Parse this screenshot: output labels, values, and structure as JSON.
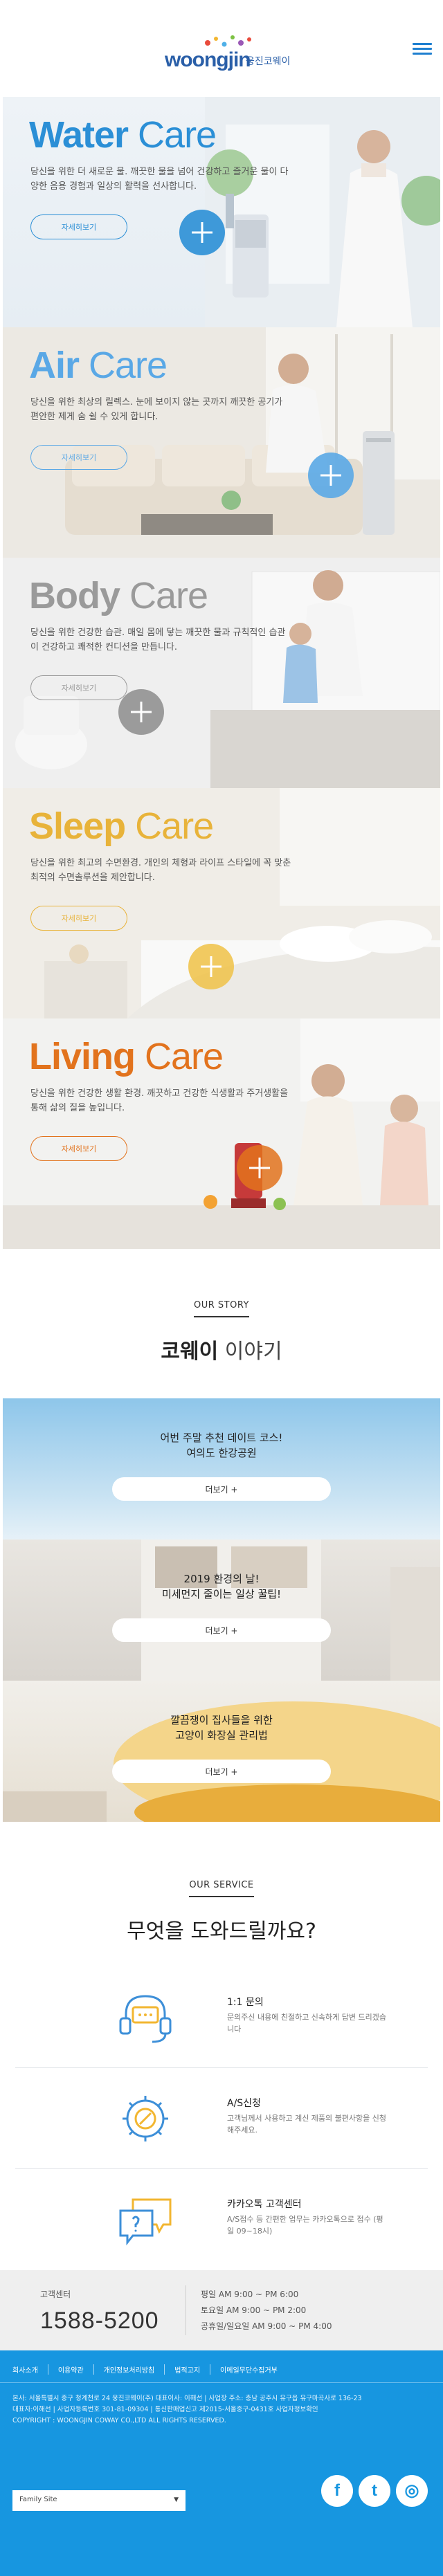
{
  "header": {
    "logo_word": "woongjin",
    "logo_kor": "웅진코웨이"
  },
  "cares": [
    {
      "word": "Water",
      "rest": " Care",
      "color": "#2b8fd6",
      "desc": "당신을 위한 더 새로운 물. 깨끗한 물을 넘어 건강하고 즐거운 물이 다양한 음용 경험과 일상의 활력을 선사합니다.",
      "more": "자세히보기"
    },
    {
      "word": "Air",
      "rest": " Care",
      "color": "#5aa8e6",
      "desc": "당신을 위한 최상의 릴렉스. 눈에 보이지 않는 곳까지 깨끗한 공기가 편안한 제게 숨 쉴 수 있게 합니다.",
      "more": "자세히보기"
    },
    {
      "word": "Body",
      "rest": " Care",
      "color": "#9a9a9a",
      "desc": "당신을 위한 건강한 습관. 매일 몸에 닿는 깨끗한 물과 규칙적인 습관이 건강하고 쾌적한 컨디션을 만듭니다.",
      "more": "자세히보기"
    },
    {
      "word": "Sleep",
      "rest": " Care",
      "color": "#e8b33a",
      "desc": "당신을 위한 최고의 수면환경. 개인의 체형과 라이프 스타일에 꼭 맞춘 최적의 수면솔루션을 제안합니다.",
      "more": "자세히보기"
    },
    {
      "word": "Living",
      "rest": " Care",
      "color": "#e2731d",
      "desc": "당신을 위한 건강한 생활 환경. 깨끗하고 건강한 식생활과 주거생활을 통해 삶의 질을 높입니다.",
      "more": "자세히보기"
    }
  ],
  "story": {
    "eyebrow": "OUR STORY",
    "title_bold": "코웨이",
    "title_light": " 이야기",
    "items": [
      {
        "line1": "어번 주말 추천 데이트 코스!",
        "line2": "여의도 한강공원",
        "button": "더보기 +"
      },
      {
        "line1": "2019 환경의 날!",
        "line2": "미세먼지 줄이는 일상 꿀팁!",
        "button": "더보기 +"
      },
      {
        "line1": "깔끔쟁이 집사들을 위한",
        "line2": "고양이 화장실 관리법",
        "button": "더보기 +"
      }
    ]
  },
  "service": {
    "eyebrow": "OUR SERVICE",
    "title": "무엇을 도와드릴까요?",
    "items": [
      {
        "icon": "headset-icon",
        "title": "1:1 문의",
        "desc": "문의주신 내용에 친절하고 신속하게 답변 드리겠습니다"
      },
      {
        "icon": "gear-wrench-icon",
        "title": "A/S신청",
        "desc": "고객님께서 사용하고 계신 제품의 불편사항을 신청해주세요."
      },
      {
        "icon": "chat-bubble-icon",
        "title": "카카오톡 고객센터",
        "desc": "A/S접수 등 간편한 업무는 카카오톡으로 접수 (평일 09~18시)"
      }
    ]
  },
  "call": {
    "label": "고객센터",
    "number": "1588-5200",
    "hours": [
      "평일 AM 9:00 ~ PM 6:00",
      "토요일 AM 9:00 ~ PM 2:00",
      "공휴일/일요일 AM 9:00 ~ PM 4:00"
    ]
  },
  "footer": {
    "links": [
      "회사소개",
      "이용약관",
      "개인정보처리방침",
      "법적고지",
      "이메일무단수집거부"
    ],
    "info": [
      "본사: 서울특별시 중구 청계천로 24 웅진코웨이(주) 대표이사: 이해선 | 사업장 주소: 충남 공주시 유구읍 유구마곡사로 136-23",
      "대표자:이해선 | 사업자등록번호 301-81-09304 | 통신판매업신고 제2015-서울중구-0431호 사업자정보확인",
      "COPYRIGHT : WOONGJIN COWAY CO.,LTD ALL RIGHTS RESERVED."
    ],
    "family_site": "Family Site",
    "social": [
      {
        "icon": "facebook-icon",
        "glyph": "f"
      },
      {
        "icon": "twitter-icon",
        "glyph": "t"
      },
      {
        "icon": "instagram-icon",
        "glyph": "◎"
      }
    ]
  }
}
